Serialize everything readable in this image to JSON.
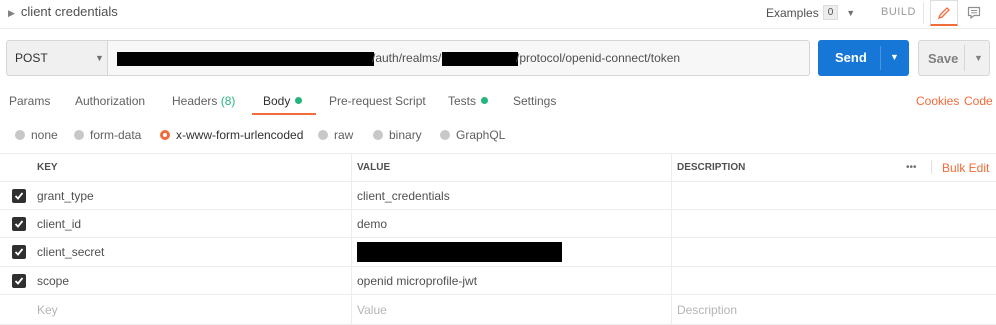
{
  "header": {
    "request_name": "client credentials",
    "examples_label": "Examples",
    "examples_count": "0",
    "build_label": "BUILD"
  },
  "request": {
    "method": "POST",
    "url_part_1": "/auth/realms/",
    "url_part_2": "/protocol/openid-connect/token",
    "send_label": "Send",
    "save_label": "Save"
  },
  "tabs": {
    "params": "Params",
    "authorization": "Authorization",
    "headers": "Headers",
    "headers_count": "(8)",
    "body": "Body",
    "prerequest": "Pre-request Script",
    "tests": "Tests",
    "settings": "Settings",
    "cookies": "Cookies",
    "code": "Code"
  },
  "body_types": {
    "none": "none",
    "form_data": "form-data",
    "urlencoded": "x-www-form-urlencoded",
    "raw": "raw",
    "binary": "binary",
    "graphql": "GraphQL",
    "selected": "x-www-form-urlencoded"
  },
  "table": {
    "headers": {
      "key": "KEY",
      "value": "VALUE",
      "description": "DESCRIPTION",
      "more": "•••",
      "bulk_edit": "Bulk Edit"
    },
    "rows": [
      {
        "key": "grant_type",
        "value": "client_credentials",
        "checked": true
      },
      {
        "key": "client_id",
        "value": "demo",
        "checked": true
      },
      {
        "key": "client_secret",
        "value": "",
        "checked": true
      },
      {
        "key": "scope",
        "value": "openid microprofile-jwt",
        "checked": true
      }
    ],
    "placeholders": {
      "key": "Key",
      "value": "Value",
      "description": "Description"
    }
  },
  "colors": {
    "accent": "#f26b3a",
    "send": "#1777d6",
    "status_dot": "#26b47f"
  }
}
